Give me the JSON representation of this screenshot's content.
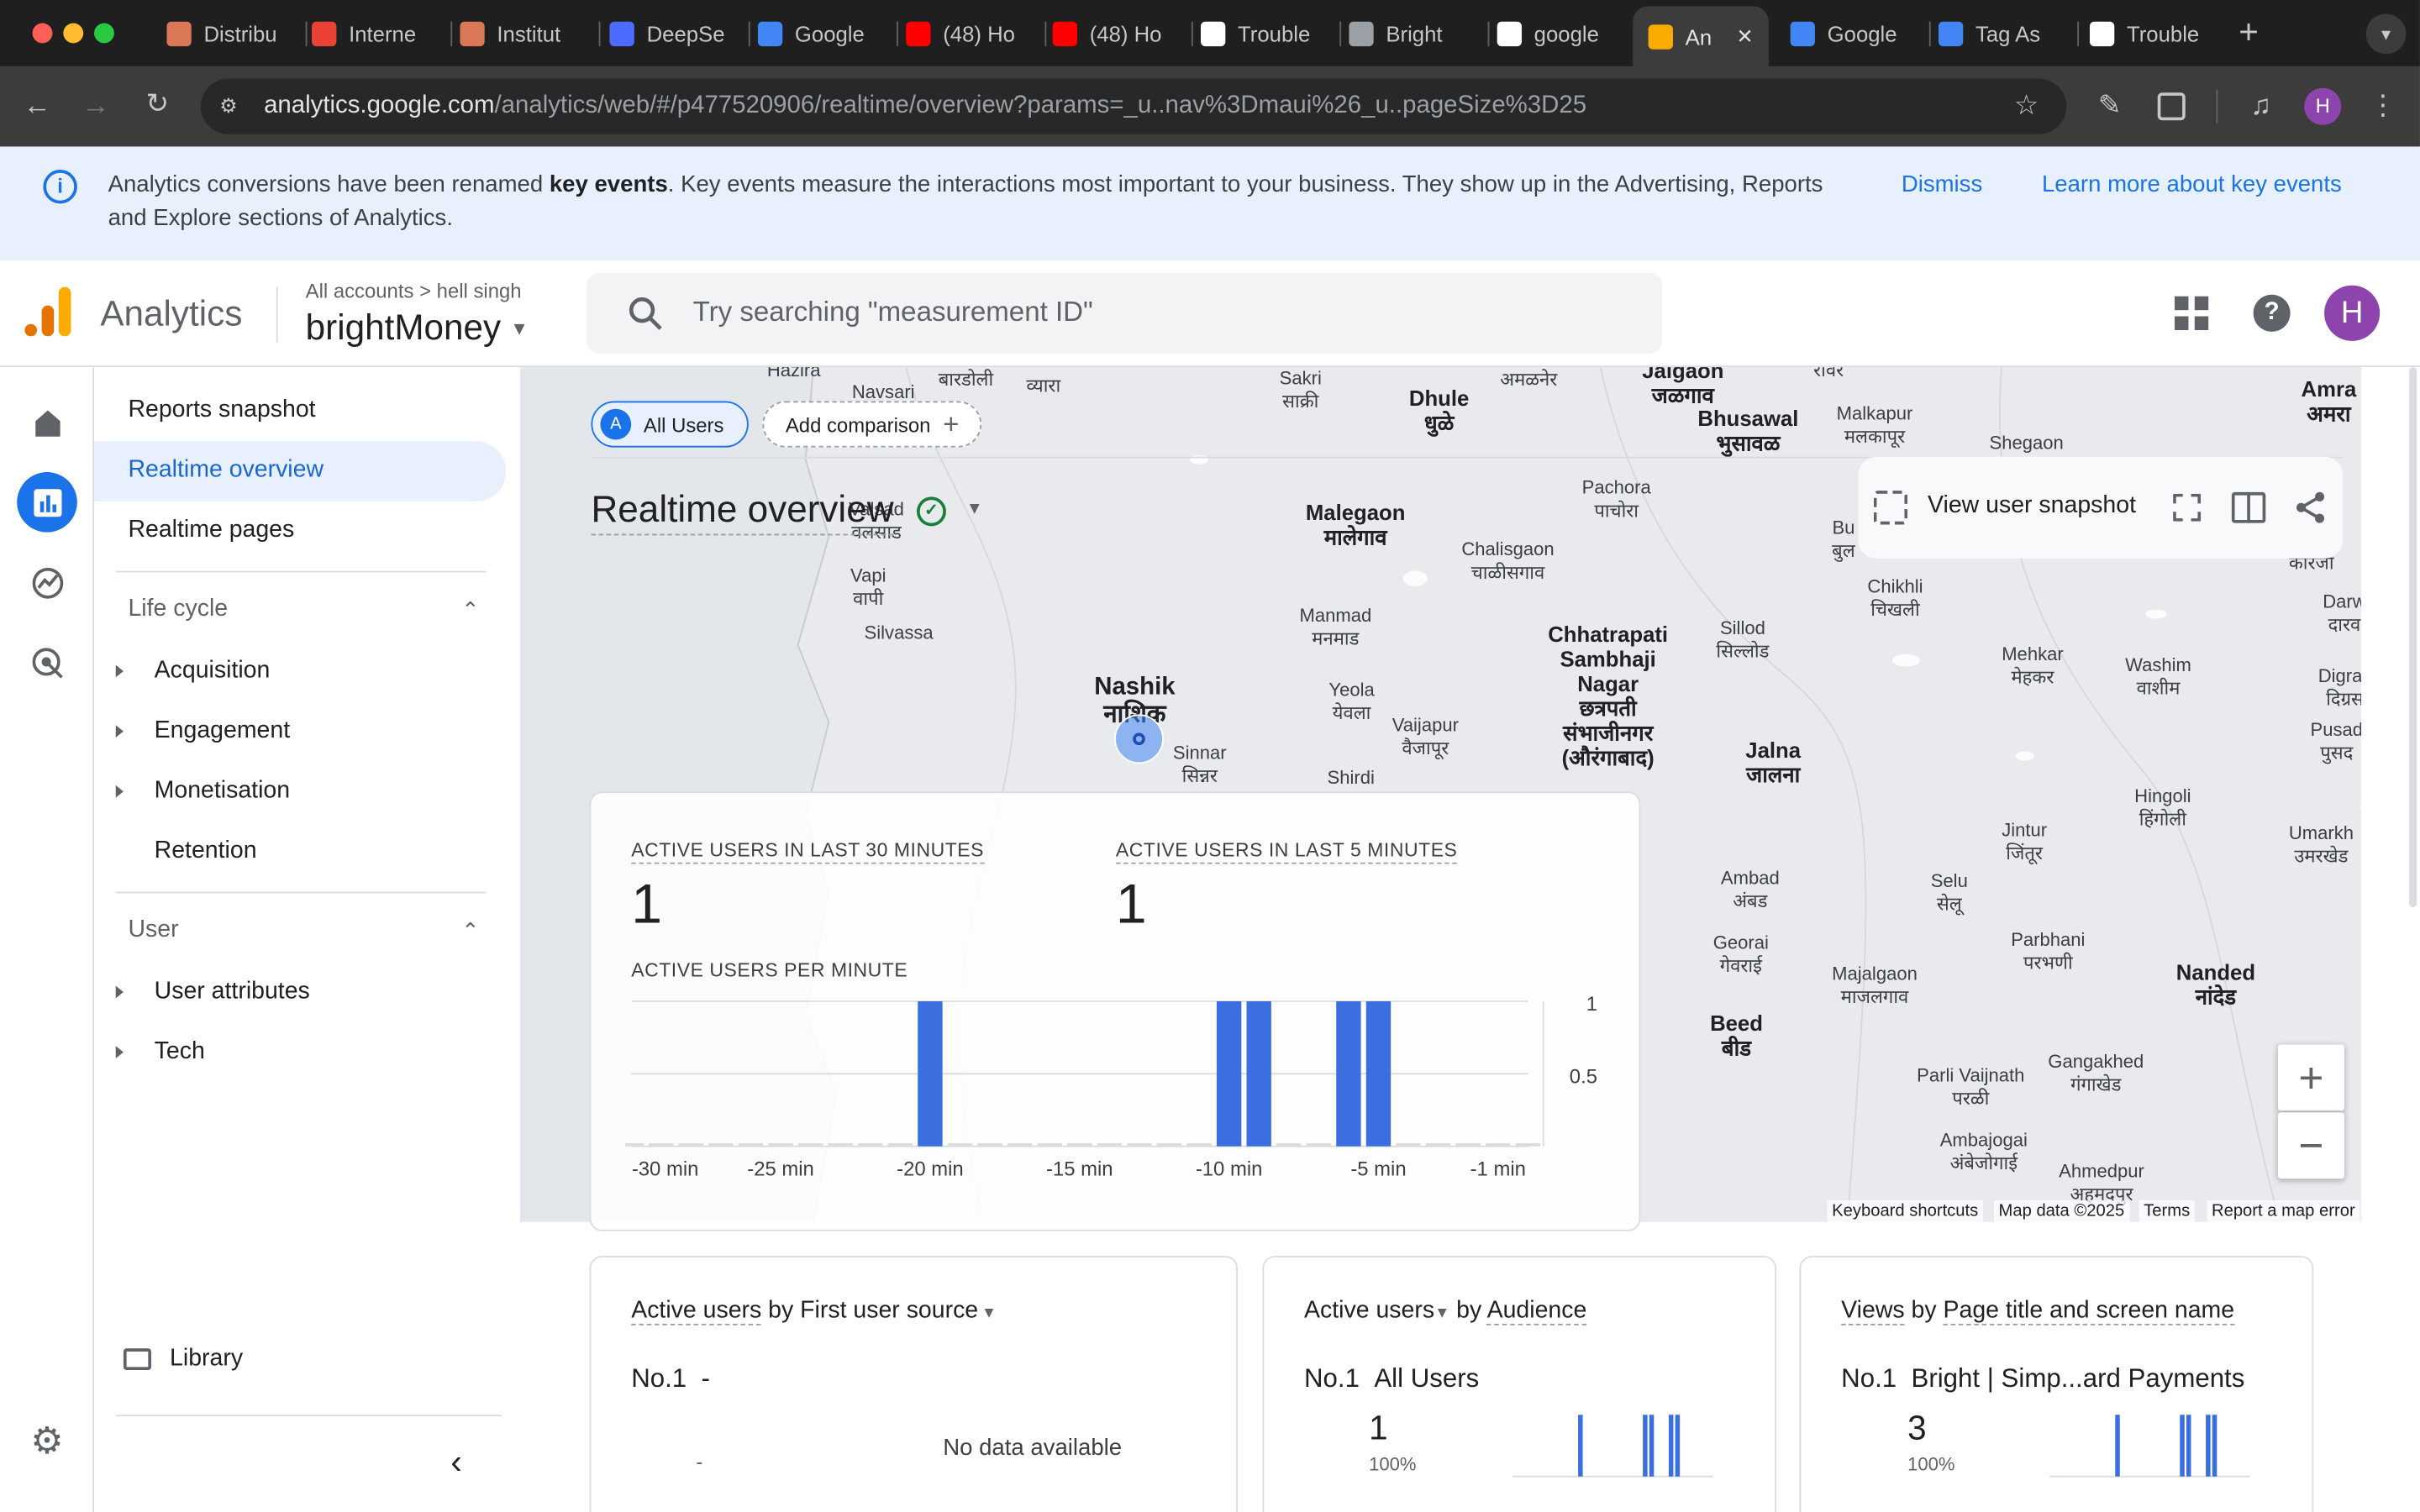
{
  "browser": {
    "tabs": [
      {
        "label": "Distribu",
        "color": "#d97757"
      },
      {
        "label": "Interne",
        "color": "#ea4335"
      },
      {
        "label": "Institut",
        "color": "#d97757"
      },
      {
        "label": "DeepSe",
        "color": "#4d6bfe"
      },
      {
        "label": "Google",
        "color": "#4285f4"
      },
      {
        "label": "(48) Ho",
        "color": "#ff0000"
      },
      {
        "label": "(48) Ho",
        "color": "#ff0000"
      },
      {
        "label": "Trouble",
        "color": "#ffffff"
      },
      {
        "label": "Bright",
        "color": "#9aa0a6"
      },
      {
        "label": "google",
        "color": "#ffffff"
      },
      {
        "label": "An",
        "color": "#f9ab00"
      },
      {
        "label": "Google",
        "color": "#4285f4"
      },
      {
        "label": "Tag As",
        "color": "#4285f4"
      },
      {
        "label": "Trouble",
        "color": "#ffffff"
      }
    ],
    "url_host": "analytics.google.com",
    "url_path": "/analytics/web/#/p477520906/realtime/overview?params=_u..nav%3Dmaui%26_u..pageSize%3D25",
    "profile_initial": "H"
  },
  "banner": {
    "text_before": "Analytics conversions have been renamed ",
    "text_bold": "key events",
    "text_after": ". Key events measure the interactions most important to your business. They show up in the Advertising, Reports and Explore sections of Analytics.",
    "dismiss": "Dismiss",
    "learn_more": "Learn more about key events"
  },
  "header": {
    "product": "Analytics",
    "breadcrumb_root": "All accounts",
    "breadcrumb_sep": ">",
    "breadcrumb_account": "hell singh",
    "property": "brightMoney",
    "search_placeholder": "Try searching \"measurement ID\"",
    "avatar_initial": "H"
  },
  "sidebar": {
    "top_items": [
      "Reports snapshot",
      "Realtime overview",
      "Realtime pages"
    ],
    "lifecycle_heading": "Life cycle",
    "lifecycle_items": [
      "Acquisition",
      "Engagement",
      "Monetisation",
      "Retention"
    ],
    "user_heading": "User",
    "user_items": [
      "User attributes",
      "Tech"
    ],
    "library": "Library"
  },
  "content": {
    "chip_all_users": "All Users",
    "chip_all_users_letter": "A",
    "add_comparison": "Add comparison",
    "page_title": "Realtime overview",
    "view_user_snapshot": "View user snapshot"
  },
  "map": {
    "labels": [
      {
        "t": "Hazira",
        "x": 497,
        "y": 233,
        "c": "s"
      },
      {
        "t": "Navsari",
        "x": 552,
        "y": 247,
        "c": "s"
      },
      {
        "t": "बारडोली",
        "x": 608,
        "y": 239,
        "c": "s"
      },
      {
        "t": "व्यारा",
        "x": 665,
        "y": 243,
        "c": "s"
      },
      {
        "t": "Sakri\nसाक्री",
        "x": 829,
        "y": 238,
        "c": "s"
      },
      {
        "t": "Dhule\nधुळे",
        "x": 913,
        "y": 250,
        "c": "m"
      },
      {
        "t": "अमळनेर",
        "x": 972,
        "y": 239,
        "c": "s"
      },
      {
        "t": "Jalgaon\nजळगाव",
        "x": 1064,
        "y": 232,
        "c": "m"
      },
      {
        "t": "रावर",
        "x": 1175,
        "y": 233,
        "c": "s"
      },
      {
        "t": "Bhusawal\nभुसावळ",
        "x": 1100,
        "y": 263,
        "c": "m"
      },
      {
        "t": "Malkapur\nमलकापूर",
        "x": 1190,
        "y": 261,
        "c": "s"
      },
      {
        "t": "Shegaon",
        "x": 1289,
        "y": 280,
        "c": "s"
      },
      {
        "t": "Amra\nअमरा",
        "x": 1491,
        "y": 244,
        "c": "m"
      },
      {
        "t": "Pachora\nपाचोरा",
        "x": 1025,
        "y": 309,
        "c": "s"
      },
      {
        "t": "Valsad\nवलसाड",
        "x": 550,
        "y": 323,
        "c": "s"
      },
      {
        "t": "Malegaon\nमालेगाव",
        "x": 846,
        "y": 324,
        "c": "m"
      },
      {
        "t": "Chalisgaon\nचाळीसगाव",
        "x": 947,
        "y": 349,
        "c": "s"
      },
      {
        "t": "Bu\nबुल",
        "x": 1187,
        "y": 335,
        "c": "s"
      },
      {
        "t": "Chikhli\nचिखली",
        "x": 1210,
        "y": 373,
        "c": "s"
      },
      {
        "t": "कारंजा",
        "x": 1483,
        "y": 358,
        "c": "s"
      },
      {
        "t": "Vapi\nवापी",
        "x": 551,
        "y": 366,
        "c": "s"
      },
      {
        "t": "Silvassa",
        "x": 560,
        "y": 403,
        "c": "s"
      },
      {
        "t": "Manmad\nमनमाड",
        "x": 842,
        "y": 392,
        "c": "s"
      },
      {
        "t": "Chhatrapati\nSambhaji\nNagar\nछत्रपती\nसंभाजीनगर\n(औरंगाबाद)",
        "x": 1003,
        "y": 403,
        "c": "m"
      },
      {
        "t": "Sillod\nसिल्लोड",
        "x": 1112,
        "y": 400,
        "c": "s"
      },
      {
        "t": "Mehkar\nमेहकर",
        "x": 1297,
        "y": 417,
        "c": "s"
      },
      {
        "t": "Washim\nवाशीम",
        "x": 1377,
        "y": 424,
        "c": "s"
      },
      {
        "t": "Darw\nदारव",
        "x": 1505,
        "y": 383,
        "c": "s"
      },
      {
        "t": "Digras\nदिग्रस",
        "x": 1502,
        "y": 431,
        "c": "s"
      },
      {
        "t": "Nashik\nनाशिक",
        "x": 709,
        "y": 437,
        "c": "b"
      },
      {
        "t": "Yeola\nयेवला",
        "x": 861,
        "y": 440,
        "c": "s"
      },
      {
        "t": "Vaijapur\nवैजापूर",
        "x": 902,
        "y": 463,
        "c": "s"
      },
      {
        "t": "Jalna\nजालना",
        "x": 1131,
        "y": 478,
        "c": "m"
      },
      {
        "t": "Pusad\nपुसद",
        "x": 1497,
        "y": 466,
        "c": "s"
      },
      {
        "t": "Sinnar\nसिन्नर",
        "x": 760,
        "y": 481,
        "c": "s"
      },
      {
        "t": "Shirdi",
        "x": 860,
        "y": 497,
        "c": "s"
      },
      {
        "t": "Hingoli\nहिंगोली",
        "x": 1383,
        "y": 509,
        "c": "s"
      },
      {
        "t": "Jintur\nजिंतूर",
        "x": 1297,
        "y": 531,
        "c": "s"
      },
      {
        "t": "Umarkh\nउमरखेड",
        "x": 1483,
        "y": 533,
        "c": "s"
      },
      {
        "t": "Ambad\nअंबड",
        "x": 1115,
        "y": 562,
        "c": "s"
      },
      {
        "t": "Selu\nसेलू",
        "x": 1251,
        "y": 564,
        "c": "s"
      },
      {
        "t": "Georai\nगेवराई",
        "x": 1110,
        "y": 604,
        "c": "s"
      },
      {
        "t": "Parbhani\nपरभणी",
        "x": 1303,
        "y": 602,
        "c": "s"
      },
      {
        "t": "Majalgaon\nमाजलगाव",
        "x": 1187,
        "y": 624,
        "c": "s"
      },
      {
        "t": "Nanded\nनांदेड",
        "x": 1410,
        "y": 622,
        "c": "m"
      },
      {
        "t": "Beed\nबीड",
        "x": 1108,
        "y": 655,
        "c": "m"
      },
      {
        "t": "Gangakhed\nगंगाखेड",
        "x": 1327,
        "y": 681,
        "c": "s"
      },
      {
        "t": "Parli Vaijnath\nपरळी",
        "x": 1242,
        "y": 690,
        "c": "s"
      },
      {
        "t": "Ambajogai\nअंबेजोगाई",
        "x": 1257,
        "y": 732,
        "c": "s"
      },
      {
        "t": "Ahmedpur\nअहमदपुर",
        "x": 1334,
        "y": 752,
        "c": "s"
      }
    ],
    "user_marker": {
      "lat_label": "Nashik"
    },
    "keyboard_shortcuts": "Keyboard shortcuts",
    "map_data": "Map data ©2025",
    "terms": "Terms",
    "report_error": "Report a map error",
    "zoom_in": "+",
    "zoom_out": "−"
  },
  "realtime_card": {
    "label_30": "ACTIVE USERS IN LAST 30 MINUTES",
    "value_30": "1",
    "label_5": "ACTIVE USERS IN LAST 5 MINUTES",
    "value_5": "1",
    "per_minute_label": "ACTIVE USERS PER MINUTE",
    "y_ticks": [
      "1",
      "0.5"
    ],
    "x_ticks": [
      "-30 min",
      "-25 min",
      "-20 min",
      "-15 min",
      "-10 min",
      "-5 min",
      "-1 min"
    ]
  },
  "chart_data": {
    "type": "bar",
    "title": "ACTIVE USERS PER MINUTE",
    "x": [
      -30,
      -29,
      -28,
      -27,
      -26,
      -25,
      -24,
      -23,
      -22,
      -21,
      -20,
      -19,
      -18,
      -17,
      -16,
      -15,
      -14,
      -13,
      -12,
      -11,
      -10,
      -9,
      -8,
      -7,
      -6,
      -5,
      -4,
      -3,
      -2,
      -1,
      0
    ],
    "values": [
      0,
      0,
      0,
      0,
      0,
      0,
      0,
      0,
      0,
      0,
      1,
      0,
      0,
      0,
      0,
      0,
      0,
      0,
      0,
      0,
      1,
      1,
      0,
      0,
      1,
      1,
      0,
      0,
      0,
      0,
      0
    ],
    "ylim": [
      0,
      1
    ],
    "y_ticks": [
      0.5,
      1
    ],
    "grid": true
  },
  "bottom_cards": [
    {
      "title_a": "Active users",
      "title_mid": " by ",
      "title_b": "First user source",
      "rank": "No.1",
      "rank_value": "-",
      "value": "-",
      "empty": "No data available"
    },
    {
      "title_a": "Active users",
      "title_mid": " by ",
      "title_b": "Audience",
      "rank": "No.1",
      "rank_value": "All Users",
      "value": "1",
      "pct": "100%"
    },
    {
      "title_a": "Views",
      "title_mid": " by ",
      "title_b": "Page title and screen name",
      "rank": "No.1",
      "rank_value": "Bright | Simp...ard Payments",
      "value": "3",
      "pct": "100%"
    }
  ],
  "colors": {
    "accent": "#1a73e8",
    "bar": "#3b6fe0",
    "banner_bg": "#e8f0fe",
    "selected_nav": "#e8f0fe"
  }
}
